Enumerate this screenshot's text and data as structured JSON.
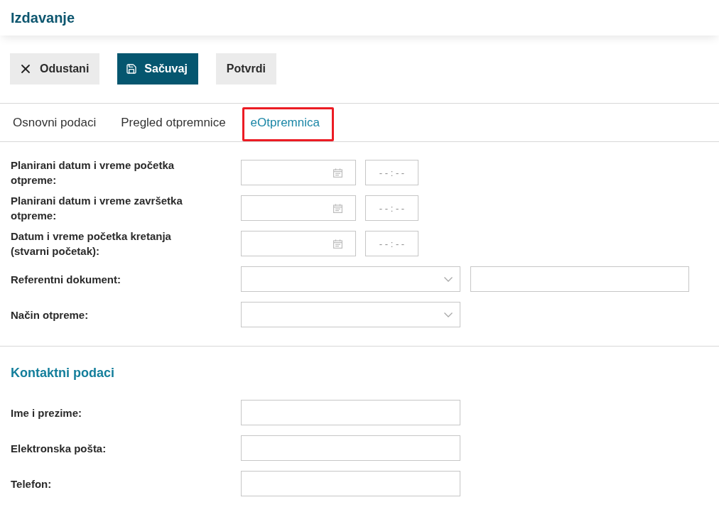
{
  "page": {
    "title": "Izdavanje"
  },
  "toolbar": {
    "buttons": [
      {
        "label": "Odustani",
        "kind": "cancel"
      },
      {
        "label": "Sačuvaj",
        "kind": "save"
      },
      {
        "label": "Potvrdi",
        "kind": "plain"
      }
    ]
  },
  "tabs": [
    {
      "label": "Osnovni podaci",
      "selected": false,
      "highlighted": false
    },
    {
      "label": "Pregled otpremnice",
      "selected": false,
      "highlighted": false
    },
    {
      "label": "eOtpremnica",
      "selected": true,
      "highlighted": true
    }
  ],
  "shipment_form": {
    "rows": [
      {
        "label": "Planirani datum i vreme početka otpreme:",
        "kind": "datetime",
        "time_placeholder": "- - : - -"
      },
      {
        "label": "Planirani datum i vreme završetka otpreme:",
        "kind": "datetime",
        "time_placeholder": "- - : - -"
      },
      {
        "label": "Datum i vreme početka kretanja (stvarni početak):",
        "kind": "datetime",
        "time_placeholder": "- - : - -"
      },
      {
        "label": "Referentni dokument:",
        "kind": "select_with_text"
      },
      {
        "label": "Način otpreme:",
        "kind": "select"
      }
    ]
  },
  "contact_section": {
    "title": "Kontaktni podaci",
    "rows": [
      {
        "label": "Ime i prezime:",
        "kind": "text"
      },
      {
        "label": "Elektronska pošta:",
        "kind": "text"
      },
      {
        "label": "Telefon:",
        "kind": "text"
      }
    ]
  }
}
